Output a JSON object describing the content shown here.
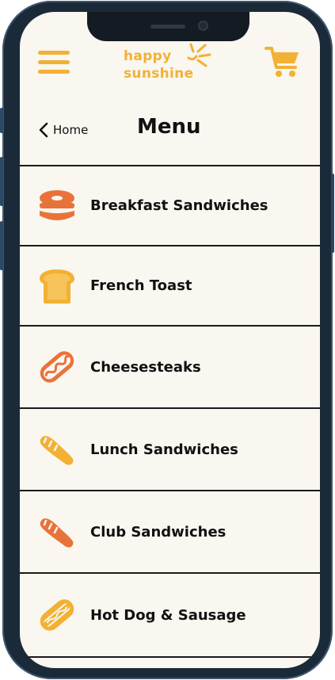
{
  "header": {
    "logo_line1": "happy",
    "logo_line2": "sunshine",
    "back_label": "Home",
    "title": "Menu"
  },
  "colors": {
    "accent_yellow": "#f2b134",
    "accent_orange": "#e8733a",
    "screen_bg": "#faf6f0",
    "frame": "#1a2a38"
  },
  "menu": {
    "items": [
      {
        "label": "Breakfast Sandwiches",
        "icon": "bagel-icon"
      },
      {
        "label": "French Toast",
        "icon": "toast-icon"
      },
      {
        "label": "Cheesesteaks",
        "icon": "sub-roll-icon"
      },
      {
        "label": "Lunch Sandwiches",
        "icon": "bread-loaf-icon"
      },
      {
        "label": "Club Sandwiches",
        "icon": "baguette-icon"
      },
      {
        "label": "Hot Dog & Sausage",
        "icon": "hot-dog-icon"
      }
    ]
  }
}
